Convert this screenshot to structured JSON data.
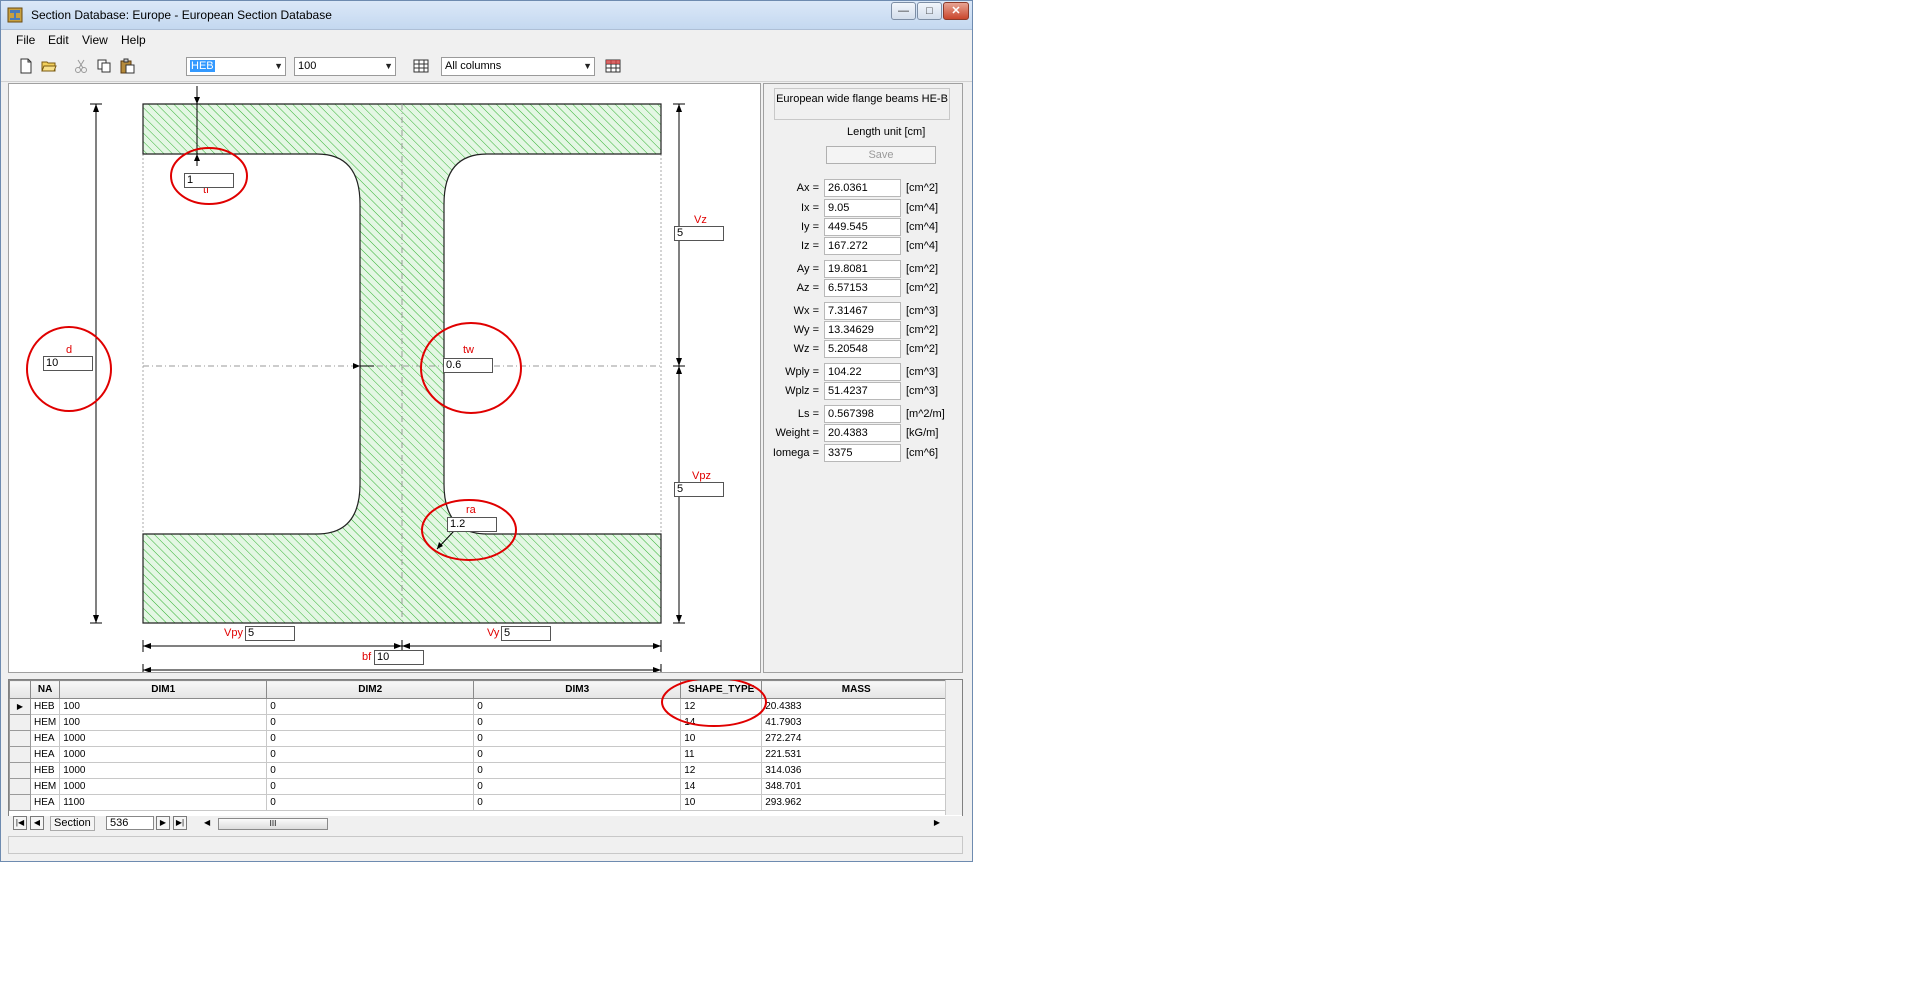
{
  "window": {
    "title": "Section Database: Europe - European Section Database",
    "minimize": "—",
    "maximize": "□",
    "close": "✕"
  },
  "menu": [
    "File",
    "Edit",
    "View",
    "Help"
  ],
  "toolbar": {
    "family_value": "HEB",
    "size_value": "100",
    "columns_value": "All columns"
  },
  "drawing": {
    "tf": {
      "label": "tf",
      "value": "1"
    },
    "d": {
      "label": "d",
      "value": "10"
    },
    "tw": {
      "label": "tw",
      "value": "0.6"
    },
    "ra": {
      "label": "ra",
      "value": "1.2"
    },
    "vz": {
      "label": "Vz",
      "value": "5"
    },
    "vpz": {
      "label": "Vpz",
      "value": "5"
    },
    "vpy": {
      "label": "Vpy",
      "value": "5"
    },
    "vy": {
      "label": "Vy",
      "value": "5"
    },
    "bf": {
      "label": "bf",
      "value": "10"
    }
  },
  "properties": {
    "description": "European wide flange beams HE-B",
    "length_unit_label": "Length unit  [cm]",
    "save_label": "Save",
    "rows": [
      {
        "label": "Ax =",
        "value": "26.0361",
        "unit": "[cm^2]"
      },
      {
        "label": "Ix =",
        "value": "9.05",
        "unit": "[cm^4]"
      },
      {
        "label": "Iy =",
        "value": "449.545",
        "unit": "[cm^4]"
      },
      {
        "label": "Iz =",
        "value": "167.272",
        "unit": "[cm^4]"
      },
      {
        "label": "Ay =",
        "value": "19.8081",
        "unit": "[cm^2]"
      },
      {
        "label": "Az =",
        "value": "6.57153",
        "unit": "[cm^2]"
      },
      {
        "label": "Wx =",
        "value": "7.31467",
        "unit": "[cm^3]"
      },
      {
        "label": "Wy =",
        "value": "13.34629",
        "unit": "[cm^2]"
      },
      {
        "label": "Wz =",
        "value": "5.20548",
        "unit": "[cm^2]"
      },
      {
        "label": "Wply =",
        "value": "104.22",
        "unit": "[cm^3]"
      },
      {
        "label": "Wplz =",
        "value": "51.4237",
        "unit": "[cm^3]"
      },
      {
        "label": "Ls =",
        "value": "0.567398",
        "unit": "[m^2/m]"
      },
      {
        "label": "Weight =",
        "value": "20.4383",
        "unit": "[kG/m]"
      },
      {
        "label": "Iomega =",
        "value": "3375",
        "unit": "[cm^6]"
      }
    ]
  },
  "grid": {
    "columns": [
      "NA",
      "DIM1",
      "DIM2",
      "DIM3",
      "SHAPE_TYPE",
      "MASS"
    ],
    "rows": [
      [
        "HEB",
        "100",
        "0",
        "0",
        "12",
        "20.4383"
      ],
      [
        "HEM",
        "100",
        "0",
        "0",
        "14",
        "41.7903"
      ],
      [
        "HEA",
        "1000",
        "0",
        "0",
        "10",
        "272.274"
      ],
      [
        "HEA",
        "1000",
        "0",
        "0",
        "11",
        "221.531"
      ],
      [
        "HEB",
        "1000",
        "0",
        "0",
        "12",
        "314.036"
      ],
      [
        "HEM",
        "1000",
        "0",
        "0",
        "14",
        "348.701"
      ],
      [
        "HEA",
        "1100",
        "0",
        "0",
        "10",
        "293.962"
      ]
    ],
    "current_row_index": 0
  },
  "navigator": {
    "label": "Section",
    "record": "536",
    "scroll_grip": "III"
  },
  "annotation_color": "#e00000",
  "hatch_color": "#33b233"
}
